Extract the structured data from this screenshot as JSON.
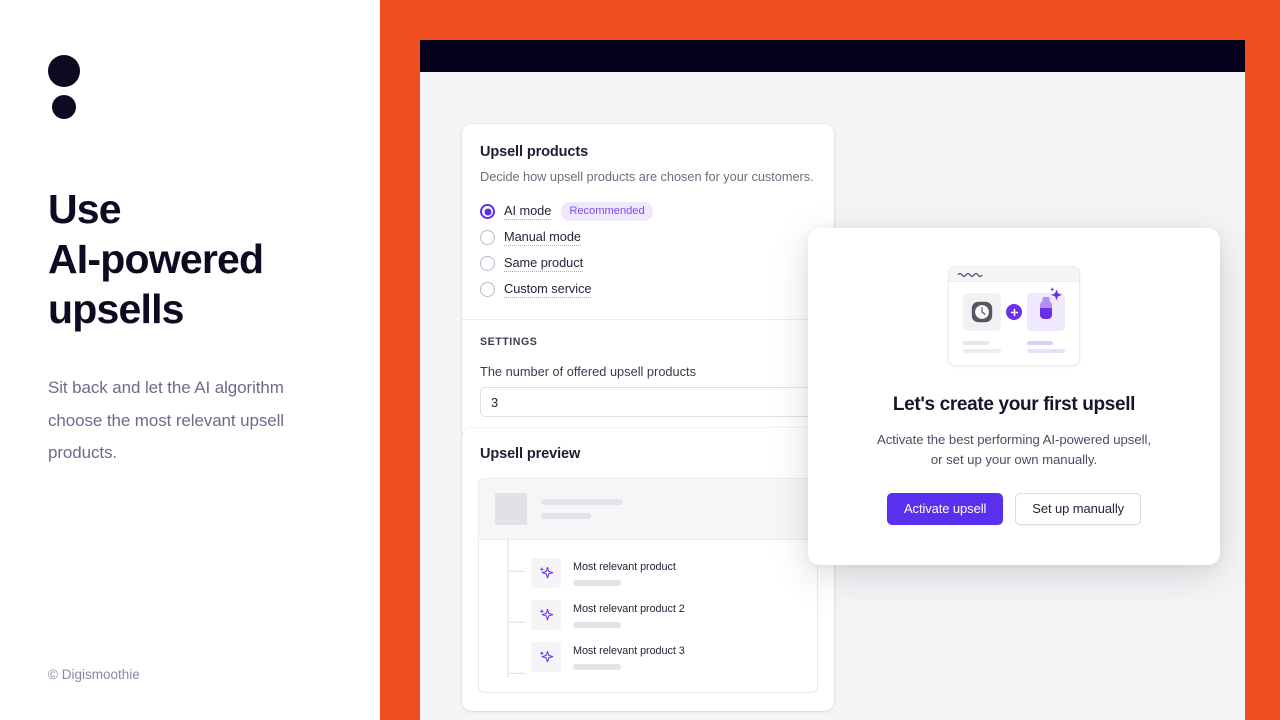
{
  "left_panel": {
    "logo_name": "digismoothie-logo",
    "headline": "Use\nAI-powered\nupsells",
    "headline_lines": [
      "Use",
      "AI-powered",
      "upsells"
    ],
    "subhead": "Sit back and let the AI algorithm choose the most relevant upsell products.",
    "copyright": "© Digismoothie"
  },
  "colors": {
    "brand_orange": "#F04E20",
    "topbar_dark": "#05011C",
    "accent_purple": "#5B2FEE",
    "badge_bg": "#EFE8FD",
    "badge_text": "#7C4DF0",
    "app_background": "#F5F5F7",
    "ink": "#0D0B21"
  },
  "browser": {
    "topbar_label": ""
  },
  "upsell_products_card": {
    "title": "Upsell products",
    "description": "Decide how upsell products are chosen for your customers.",
    "options": [
      {
        "label": "AI mode",
        "selected": true,
        "badge": "Recommended"
      },
      {
        "label": "Manual mode",
        "selected": false,
        "badge": ""
      },
      {
        "label": "Same product",
        "selected": false,
        "badge": ""
      },
      {
        "label": "Custom service",
        "selected": false,
        "badge": ""
      }
    ],
    "settings": {
      "section_title": "SETTINGS",
      "field_label": "The number of offered upsell products",
      "field_value": "3",
      "field_placeholder": "3"
    }
  },
  "upsell_preview_card": {
    "title": "Upsell preview",
    "products": [
      {
        "name": "Most relevant product",
        "icon": "sparkle-icon"
      },
      {
        "name": "Most relevant product 2",
        "icon": "sparkle-icon"
      },
      {
        "name": "Most relevant product 3",
        "icon": "sparkle-icon"
      }
    ]
  },
  "modal": {
    "illustration_name": "upsell-bundle-illustration",
    "illustration_items": [
      "watch-icon",
      "plus-icon",
      "bottle-icon",
      "sparkle-icon"
    ],
    "title": "Let's create your first upsell",
    "description_line1": "Activate the best performing AI-powered upsell,",
    "description_line2": "or set up your own manually.",
    "primary_button": "Activate upsell",
    "secondary_button": "Set up manually"
  }
}
